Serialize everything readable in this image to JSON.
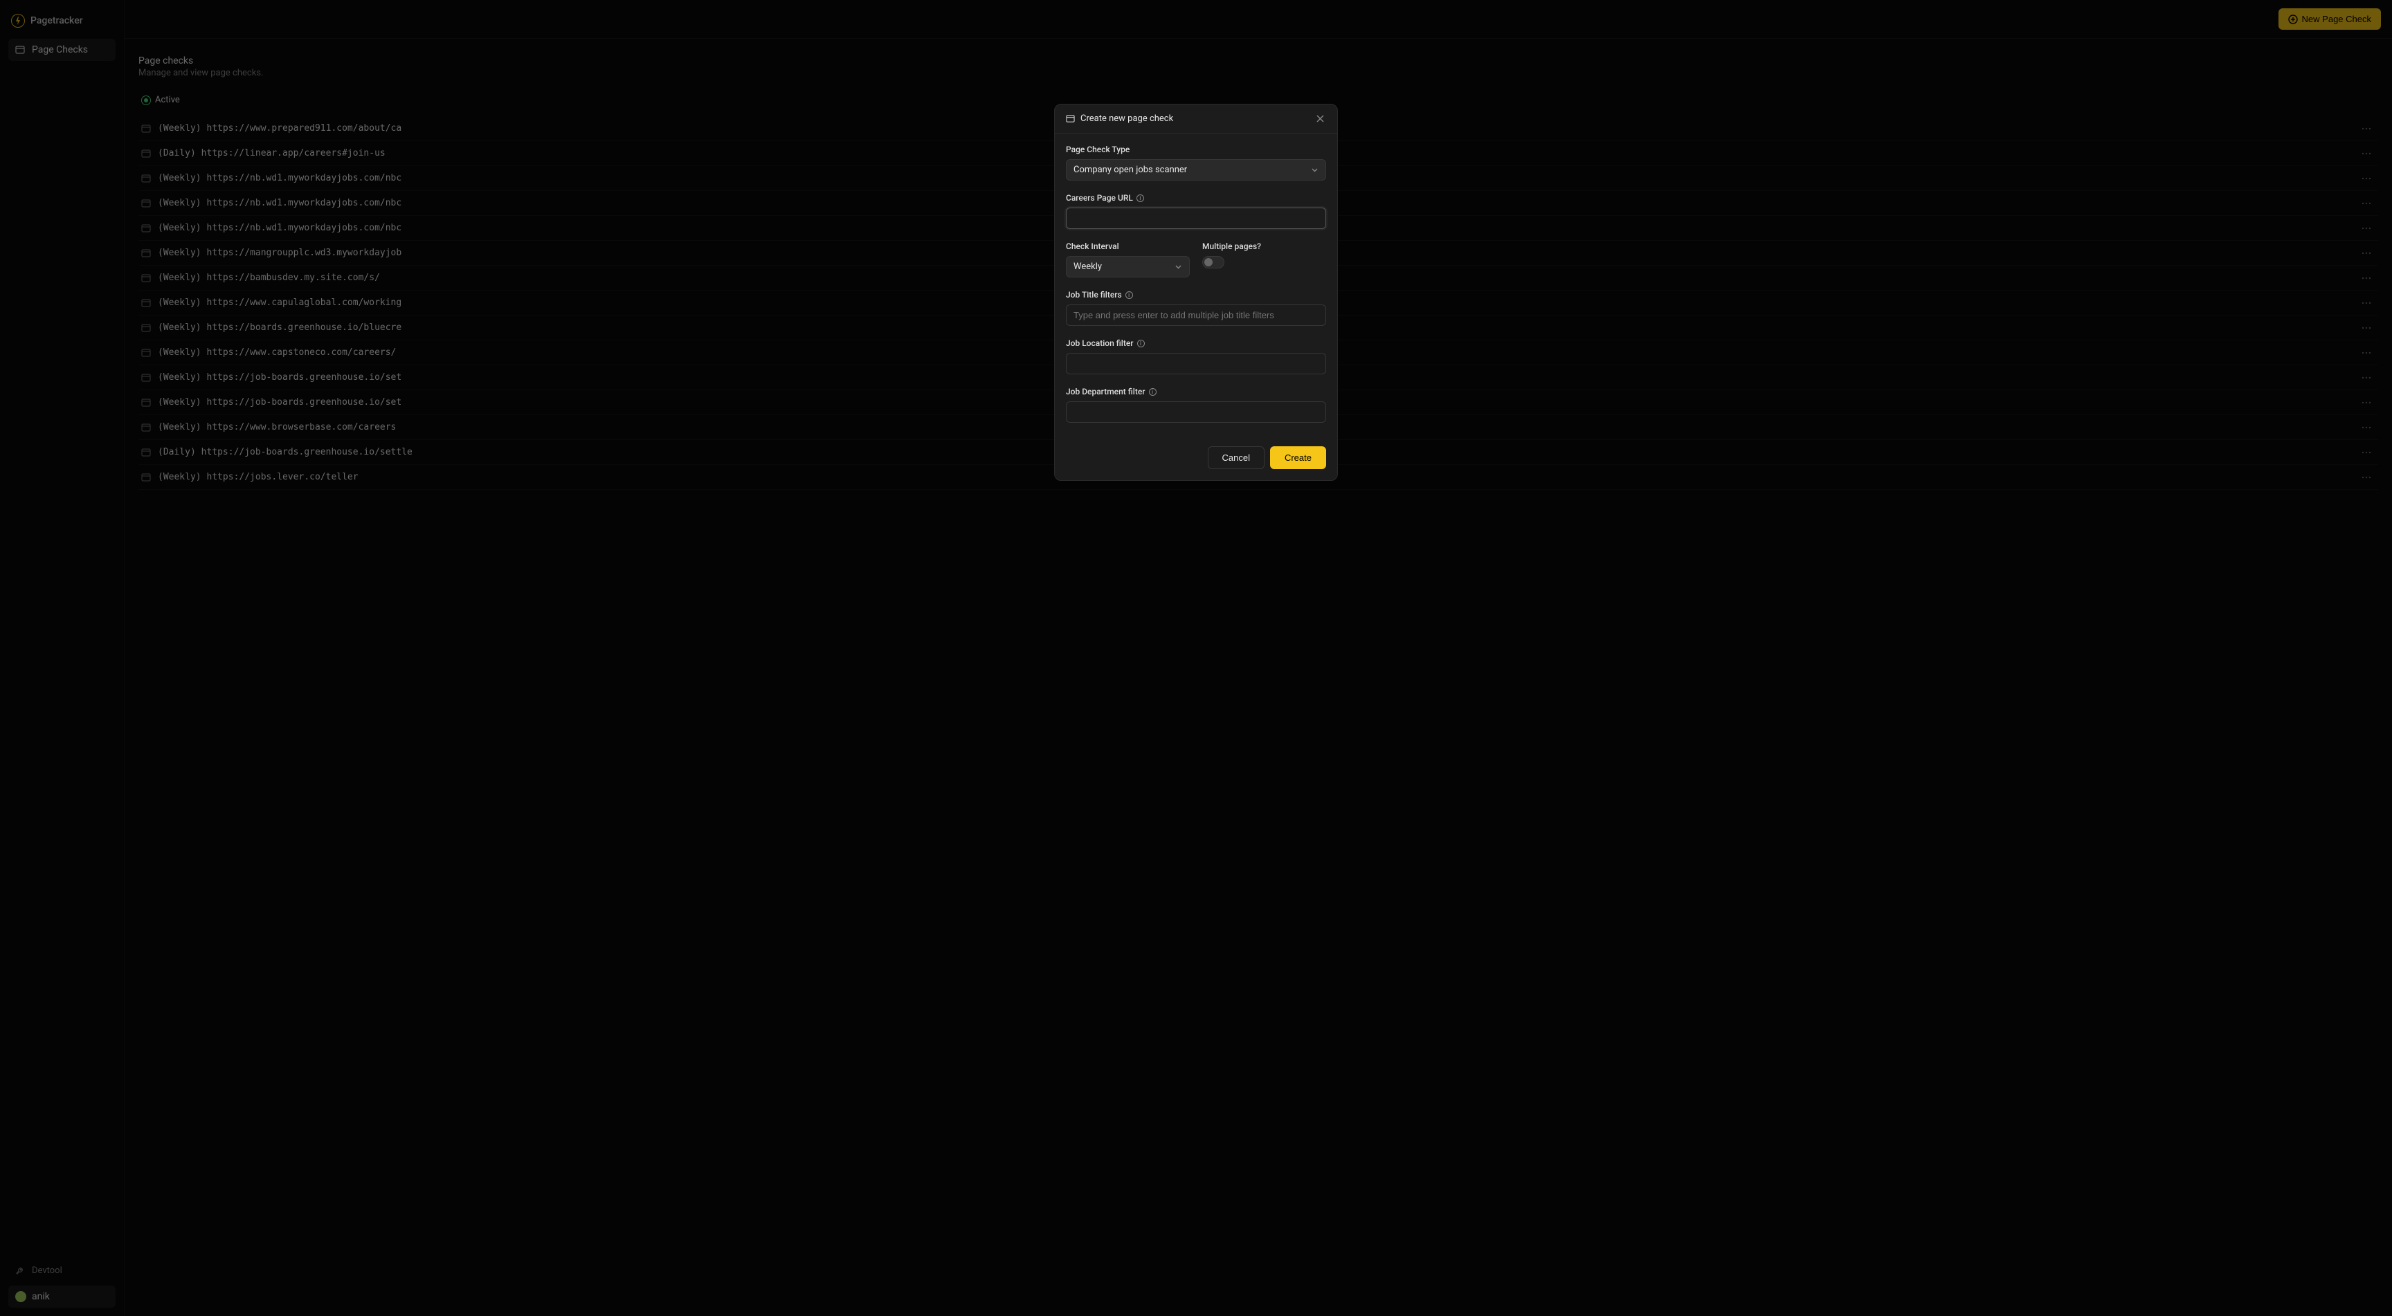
{
  "app": {
    "name": "Pagetracker"
  },
  "sidebar": {
    "nav": [
      {
        "label": "Page Checks",
        "active": true
      }
    ],
    "devtool": "Devtool",
    "user": "anik"
  },
  "topbar": {
    "new_button": "New Page Check"
  },
  "page": {
    "title": "Page checks",
    "subtitle": "Manage and view page checks."
  },
  "filters": {
    "active": "Active"
  },
  "checks": [
    {
      "text": "(Weekly) https://www.prepared911.com/about/ca"
    },
    {
      "text": "(Daily) https://linear.app/careers#join-us"
    },
    {
      "text": "(Weekly) https://nb.wd1.myworkdayjobs.com/nbc"
    },
    {
      "text": "(Weekly) https://nb.wd1.myworkdayjobs.com/nbc"
    },
    {
      "text": "(Weekly) https://nb.wd1.myworkdayjobs.com/nbc"
    },
    {
      "text": "(Weekly) https://mangroupplc.wd3.myworkdayjob"
    },
    {
      "text": "(Weekly) https://bambusdev.my.site.com/s/"
    },
    {
      "text": "(Weekly) https://www.capulaglobal.com/working"
    },
    {
      "text": "(Weekly) https://boards.greenhouse.io/bluecre"
    },
    {
      "text": "(Weekly) https://www.capstoneco.com/careers/"
    },
    {
      "text": "(Weekly) https://job-boards.greenhouse.io/set"
    },
    {
      "text": "(Weekly) https://job-boards.greenhouse.io/set"
    },
    {
      "text": "(Weekly) https://www.browserbase.com/careers"
    },
    {
      "text": "(Daily) https://job-boards.greenhouse.io/settle"
    },
    {
      "text": "(Weekly) https://jobs.lever.co/teller"
    }
  ],
  "modal": {
    "title": "Create new page check",
    "labels": {
      "page_check_type": "Page Check Type",
      "careers_url": "Careers Page URL",
      "check_interval": "Check Interval",
      "multiple_pages": "Multiple pages?",
      "job_title_filters": "Job Title filters",
      "job_location_filter": "Job Location filter",
      "job_department_filter": "Job Department filter"
    },
    "values": {
      "page_check_type": "Company open jobs scanner",
      "check_interval": "Weekly",
      "careers_url": "",
      "job_title_placeholder": "Type and press enter to add multiple job title filters"
    },
    "buttons": {
      "cancel": "Cancel",
      "create": "Create"
    }
  }
}
